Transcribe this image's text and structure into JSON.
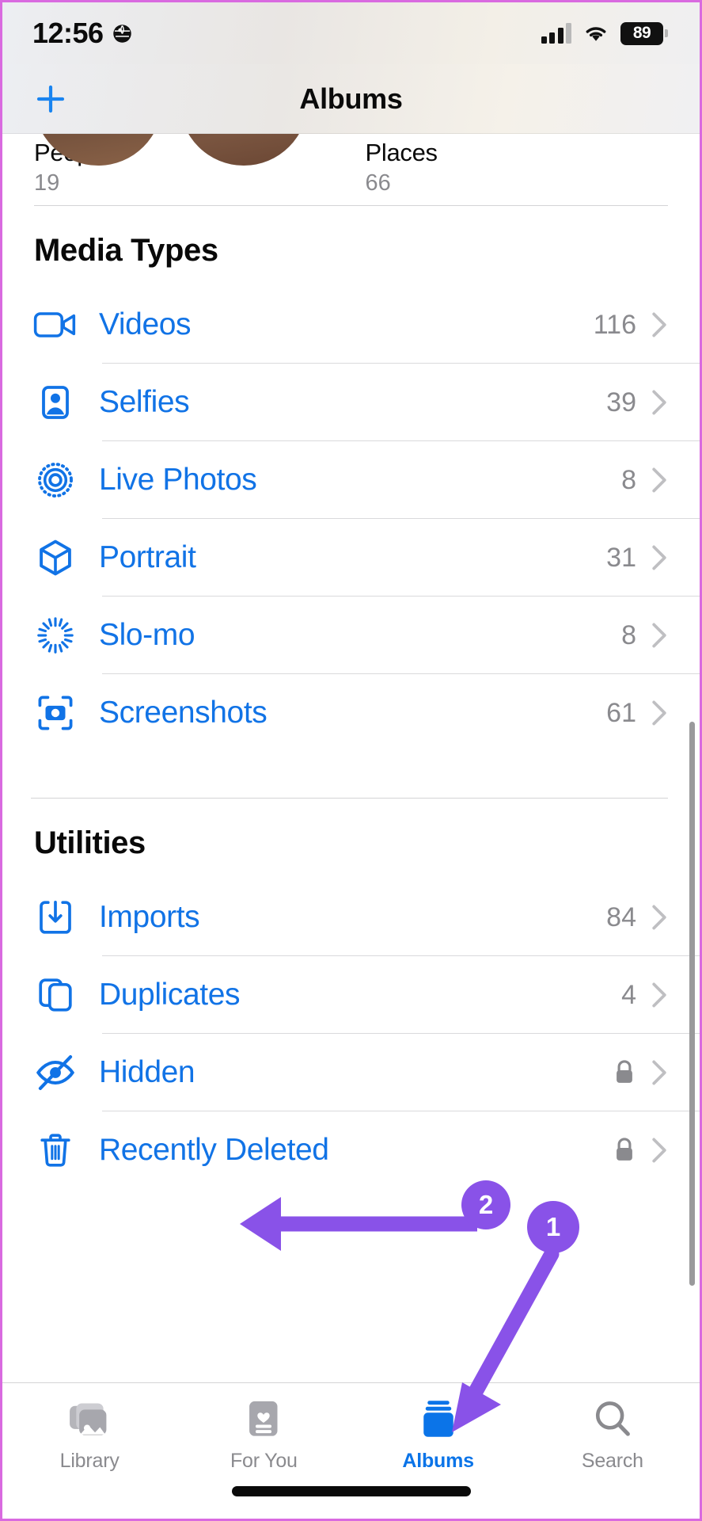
{
  "status_bar": {
    "time": "12:56",
    "globe_icon": "globe-icon",
    "cellular_icon": "cellular-signal-icon",
    "wifi_icon": "wifi-icon",
    "battery_level": "89"
  },
  "nav": {
    "title": "Albums",
    "add_icon": "plus-icon"
  },
  "top_row": [
    {
      "label": "People",
      "count": "19",
      "thumb": "people-avatars-thumbnail"
    },
    {
      "label": "Places",
      "count": "66",
      "thumb": "map-thumbnail"
    }
  ],
  "sections": [
    {
      "title": "Media Types",
      "rows": [
        {
          "label": "Videos",
          "count": "116",
          "icon": "video-camera-icon",
          "locked": false
        },
        {
          "label": "Selfies",
          "count": "39",
          "icon": "selfie-person-icon",
          "locked": false
        },
        {
          "label": "Live Photos",
          "count": "8",
          "icon": "live-photo-icon",
          "locked": false
        },
        {
          "label": "Portrait",
          "count": "31",
          "icon": "cube-icon",
          "locked": false
        },
        {
          "label": "Slo-mo",
          "count": "8",
          "icon": "slomo-burst-icon",
          "locked": false
        },
        {
          "label": "Screenshots",
          "count": "61",
          "icon": "screenshot-camera-icon",
          "locked": false
        }
      ]
    },
    {
      "title": "Utilities",
      "rows": [
        {
          "label": "Imports",
          "count": "84",
          "icon": "import-download-icon",
          "locked": false
        },
        {
          "label": "Duplicates",
          "count": "4",
          "icon": "duplicate-squares-icon",
          "locked": false
        },
        {
          "label": "Hidden",
          "count": "",
          "icon": "eye-slash-icon",
          "locked": true
        },
        {
          "label": "Recently Deleted",
          "count": "",
          "icon": "trash-icon",
          "locked": true
        }
      ]
    }
  ],
  "tabs": [
    {
      "label": "Library",
      "icon": "photo-stack-icon",
      "active": false
    },
    {
      "label": "For You",
      "icon": "for-you-card-icon",
      "active": false
    },
    {
      "label": "Albums",
      "icon": "albums-stack-icon",
      "active": true
    },
    {
      "label": "Search",
      "icon": "magnifier-icon",
      "active": false
    }
  ],
  "annotations": {
    "color": "#8952e8",
    "badges": [
      {
        "number": "1",
        "target": "albums-tab"
      },
      {
        "number": "2",
        "target": "hidden-row"
      }
    ]
  }
}
